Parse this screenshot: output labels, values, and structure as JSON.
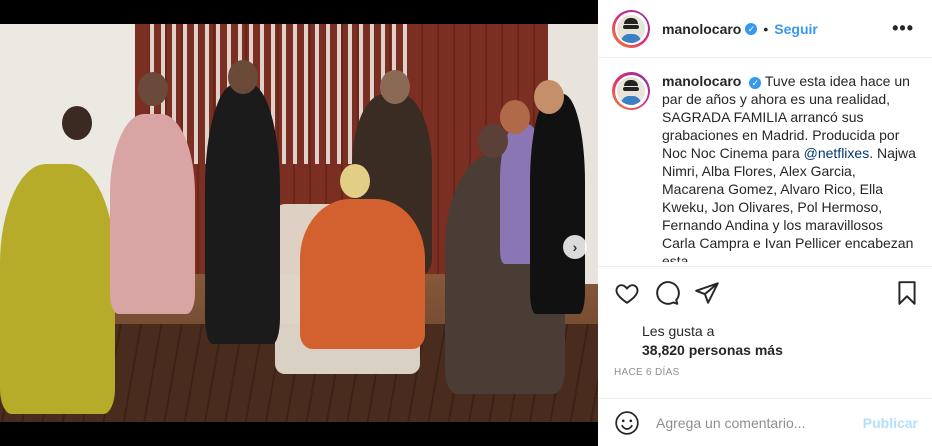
{
  "post": {
    "author": "manolocaro",
    "follow_label": "Seguir",
    "separator": "•",
    "more_icon": "•••",
    "caption_user": "manolocaro",
    "caption_part1": "Tuve esta idea hace un par de años y ahora es una realidad, SAGRADA FAMILIA arrancó sus grabaciones en Madrid. Producida por Noc Noc Cinema para ",
    "caption_mention": "@netflixes",
    "caption_part2": ". Najwa Nimri, Alba Flores, Alex Garcia, Macarena Gomez, Alvaro Rico, Ella Kweku, Jon Olivares, Pol Hermoso, Fernando Andina y los maravillosos Carla Campra e Ivan Pellicer encabezan esta",
    "likes_label": "Les gusta a",
    "likes_count": "38,820 personas más",
    "timestamp": "HACE 6 DÍAS",
    "comment_placeholder": "Agrega un comentario...",
    "publish_label": "Publicar",
    "next_icon": "›"
  },
  "icons": [
    "heart-icon",
    "comment-icon",
    "share-icon",
    "bookmark-icon",
    "emoji-icon",
    "verified-icon",
    "chevron-right-icon"
  ],
  "colors": {
    "accent": "#3897f0",
    "publish_disabled": "#b2dffc",
    "muted": "#8e8e8e"
  }
}
